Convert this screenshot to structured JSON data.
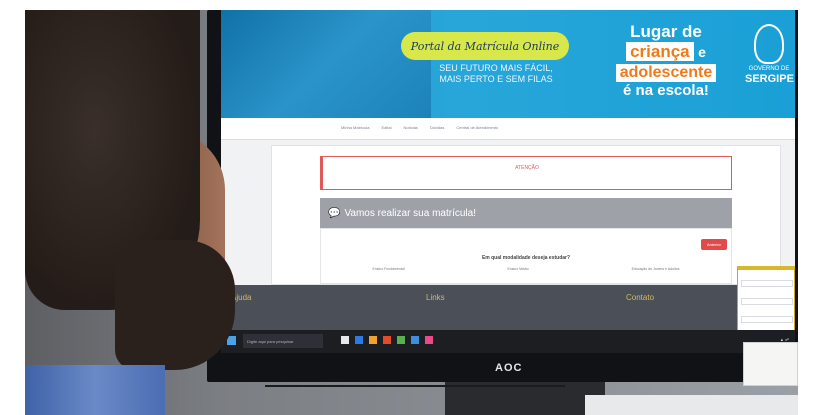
{
  "banner": {
    "portal_title": "Portal da Matrícula Online",
    "slogan_line1": "SEU FUTURO MAIS FÁCIL,",
    "slogan_line2": "MAIS PERTO E SEM FILAS",
    "campaign_line1": "Lugar de",
    "campaign_word1": "criança",
    "campaign_connector": "e",
    "campaign_word2": "adolescente",
    "campaign_line4": "é na escola!",
    "gov_line1": "GOVERNO DE",
    "gov_line2": "SERGIPE"
  },
  "navbar": {
    "items": [
      "Minha Matrícula",
      "Edital",
      "Notícias",
      "Dúvidas",
      "Central de Atendimento"
    ]
  },
  "content": {
    "alert_title": "ATENÇÃO",
    "alert_text": "",
    "panel_title": "Vamos realizar sua matrícula!",
    "prev_button": "Anterior",
    "question": "Em qual modalidade deseja estudar?",
    "options": [
      "Ensino Fundamental",
      "Ensino Médio",
      "Educação de Jovens e Adultos"
    ]
  },
  "footer": {
    "col1_title": "Ajuda",
    "col2_title": "Links",
    "col3_title": "Contato"
  },
  "taskbar": {
    "search_placeholder": "Digite aqui para pesquisar"
  },
  "monitor": {
    "brand": "AOC"
  },
  "colors": {
    "banner_blue": "#1aa0d6",
    "badge_yellow": "#d8e84a",
    "campaign_orange": "#f07a1a",
    "alert_red": "#e05a5a",
    "footer_dark": "#4b4f58"
  }
}
